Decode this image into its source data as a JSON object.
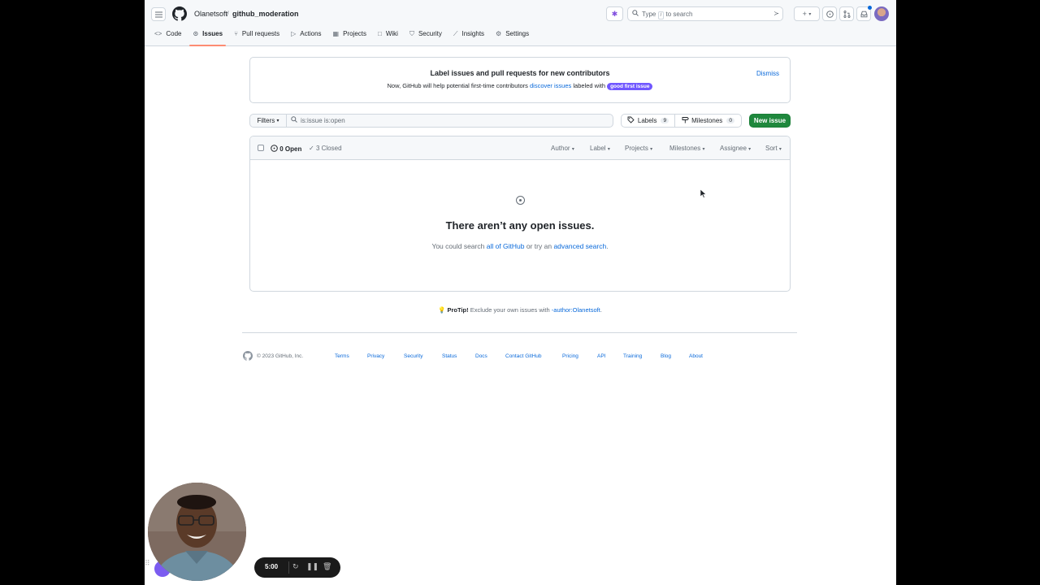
{
  "header": {
    "owner": "Olanetsoft",
    "separator": "/",
    "repo": "github_moderation",
    "search_placeholder_pre": "Type",
    "search_key": "/",
    "search_placeholder_post": "to search"
  },
  "tabs": [
    {
      "label": "Code",
      "icon": "code-icon"
    },
    {
      "label": "Issues",
      "icon": "issue-icon",
      "selected": true
    },
    {
      "label": "Pull requests",
      "icon": "pull-request-icon"
    },
    {
      "label": "Actions",
      "icon": "play-icon"
    },
    {
      "label": "Projects",
      "icon": "table-icon"
    },
    {
      "label": "Wiki",
      "icon": "book-icon"
    },
    {
      "label": "Security",
      "icon": "shield-icon"
    },
    {
      "label": "Insights",
      "icon": "graph-icon"
    },
    {
      "label": "Settings",
      "icon": "gear-icon"
    }
  ],
  "banner": {
    "title": "Label issues and pull requests for new contributors",
    "text_pre": "Now, GitHub will help potential first-time contributors",
    "link": "discover issues",
    "text_post": "labeled with",
    "label": "good first issue",
    "dismiss": "Dismiss"
  },
  "filter_bar": {
    "filters_label": "Filters",
    "query": "is:issue is:open",
    "labels_label": "Labels",
    "labels_count": "9",
    "milestones_label": "Milestones",
    "milestones_count": "0",
    "new_issue": "New issue"
  },
  "issues_header": {
    "open": "0 Open",
    "closed": "3 Closed",
    "filters": [
      "Author",
      "Label",
      "Projects",
      "Milestones",
      "Assignee",
      "Sort"
    ]
  },
  "blankslate": {
    "title": "There aren’t any open issues.",
    "sub_pre": "You could search",
    "link1": "all of GitHub",
    "sub_mid": "or try an",
    "link2": "advanced search",
    "sub_post": "."
  },
  "protip": {
    "label": "ProTip!",
    "text": "Exclude your own issues with",
    "link": "-author:Olanetsoft",
    "post": "."
  },
  "footer": {
    "copyright": "© 2023 GitHub, Inc.",
    "links": [
      "Terms",
      "Privacy",
      "Security",
      "Status",
      "Docs",
      "Contact GitHub",
      "Pricing",
      "API",
      "Training",
      "Blog",
      "About"
    ]
  },
  "recorder": {
    "time": "5:00"
  },
  "colors": {
    "accent": "#0969da",
    "primary_button": "#1f883d",
    "label_purple": "#7057ff",
    "tab_underline": "#fd8c73"
  }
}
